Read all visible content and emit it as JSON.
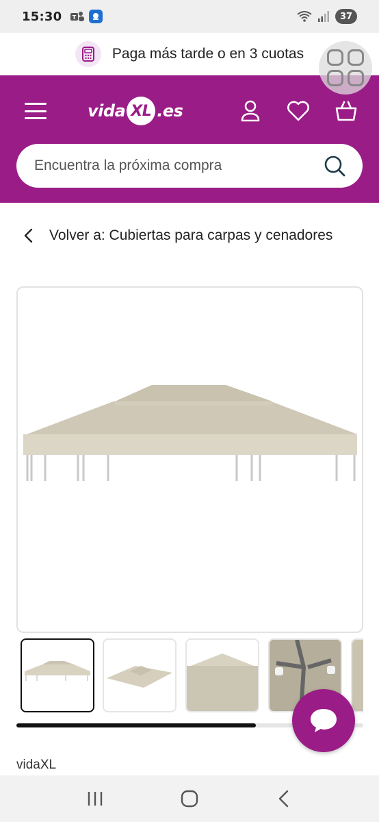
{
  "status_bar": {
    "time": "15:30",
    "battery": "37",
    "icons": [
      "teams-icon",
      "app-badge-icon",
      "wifi-icon",
      "signal-icon",
      "battery-icon"
    ]
  },
  "promo": {
    "text": "Paga más tarde o en 3 cuotas",
    "icon": "payment-terminal-icon"
  },
  "header": {
    "logo": {
      "prefix": "vida",
      "mark": "XL",
      "suffix": ".es"
    },
    "search_placeholder": "Encuentra la próxima compra",
    "icons": [
      "menu-icon",
      "account-icon",
      "heart-icon",
      "basket-icon",
      "search-icon"
    ],
    "color": "#9a1c86"
  },
  "breadcrumb": {
    "text": "Volver a: Cubiertas para carpas y cenadores"
  },
  "gallery": {
    "main_image": "beige-gazebo-roof-cover",
    "thumbnails": [
      "gazebo-cover-front",
      "gazebo-cover-top",
      "gazebo-cover-detail",
      "gazebo-frame-closeup",
      "gazebo-partial"
    ],
    "selected_index": 0,
    "scroll_progress": 0.69
  },
  "product": {
    "brand": "vidaXL"
  },
  "chat_button": {
    "icon": "chat-bubble-icon"
  },
  "navbar": {
    "items": [
      "recent-apps-icon",
      "home-icon",
      "back-icon"
    ]
  }
}
